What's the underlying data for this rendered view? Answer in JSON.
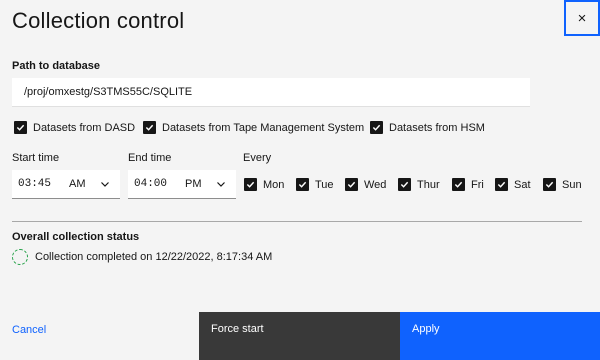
{
  "dialog": {
    "title": "Collection control",
    "close_icon": "×"
  },
  "path": {
    "label": "Path to database",
    "value": "/proj/omxestg/S3TMS55C/SQLITE"
  },
  "sources": [
    {
      "label": "Datasets from DASD",
      "checked": true
    },
    {
      "label": "Datasets from Tape Management System",
      "checked": true
    },
    {
      "label": "Datasets from HSM",
      "checked": true
    }
  ],
  "start_time": {
    "label": "Start time",
    "value": "03:45",
    "ampm": "AM"
  },
  "end_time": {
    "label": "End time",
    "value": "04:00",
    "ampm": "PM"
  },
  "every": {
    "label": "Every",
    "days": [
      {
        "label": "Mon",
        "checked": true
      },
      {
        "label": "Tue",
        "checked": true
      },
      {
        "label": "Wed",
        "checked": true
      },
      {
        "label": "Thur",
        "checked": true
      },
      {
        "label": "Fri",
        "checked": true
      },
      {
        "label": "Sat",
        "checked": true
      },
      {
        "label": "Sun",
        "checked": true
      }
    ]
  },
  "status": {
    "label": "Overall collection status",
    "text": "Collection completed on 12/22/2022, 8:17:34 AM",
    "icon": "status-in-progress-icon",
    "color": "#24a148"
  },
  "footer": {
    "cancel_label": "Cancel",
    "force_label": "Force start",
    "apply_label": "Apply"
  },
  "colors": {
    "primary": "#0f62fe",
    "secondary": "#393939",
    "background": "#f4f4f4"
  }
}
